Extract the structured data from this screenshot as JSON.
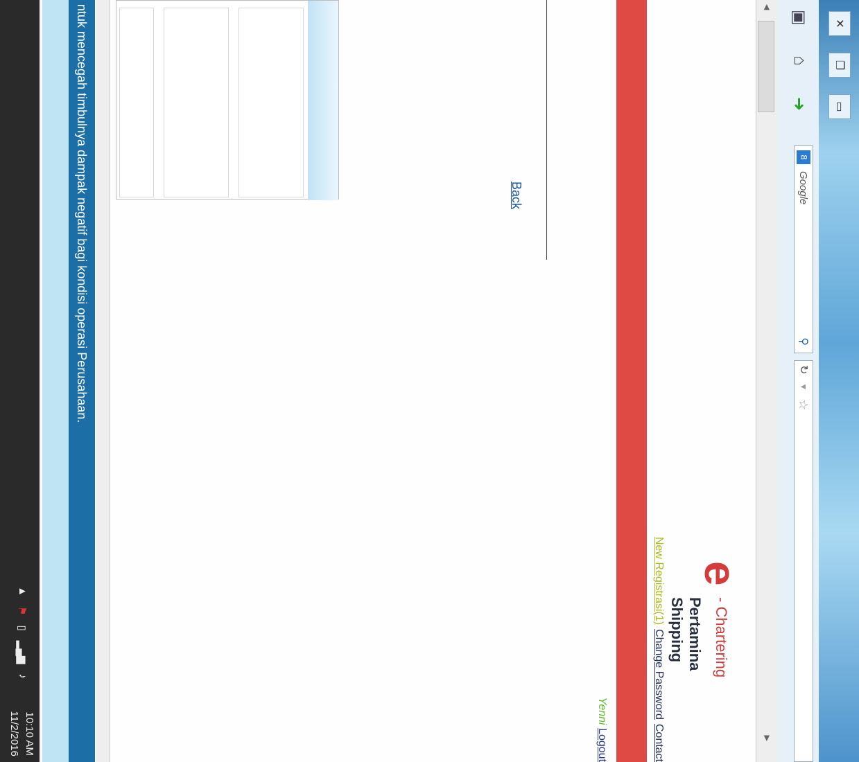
{
  "browser": {
    "search_engine_label": "Google",
    "search_badge": "8",
    "window_controls": [
      "minimize",
      "restore",
      "close"
    ],
    "icons": [
      "favorite-star-icon",
      "dropdown-icon",
      "refresh-icon",
      "search-icon",
      "forward-arrow-icon",
      "home-icon",
      "addon-icon"
    ]
  },
  "header": {
    "logo_letter": "e",
    "brand_sub": "- Chartering",
    "brand_name": "Pertamina Shipping",
    "nav": {
      "new_registration": "New Registrasi(1)",
      "change_password": "Change Password",
      "contact": "Contact"
    },
    "user": {
      "name": "Yenni",
      "logout": "Logout"
    }
  },
  "main": {
    "back_link": "Back"
  },
  "status": {
    "marquee": "ntuk mencegah timbulnya dampak negatif bagi kondisi operasi Perusahaan."
  },
  "taskbar": {
    "time": "10:10 AM",
    "date": "11/2/2016"
  },
  "colors": {
    "brand_red": "#e04a44",
    "nav_link": "#1e2f57",
    "new_registration": "#a8b81f",
    "username": "#5fb92c",
    "marquee_bg": "#1b6fa6"
  }
}
